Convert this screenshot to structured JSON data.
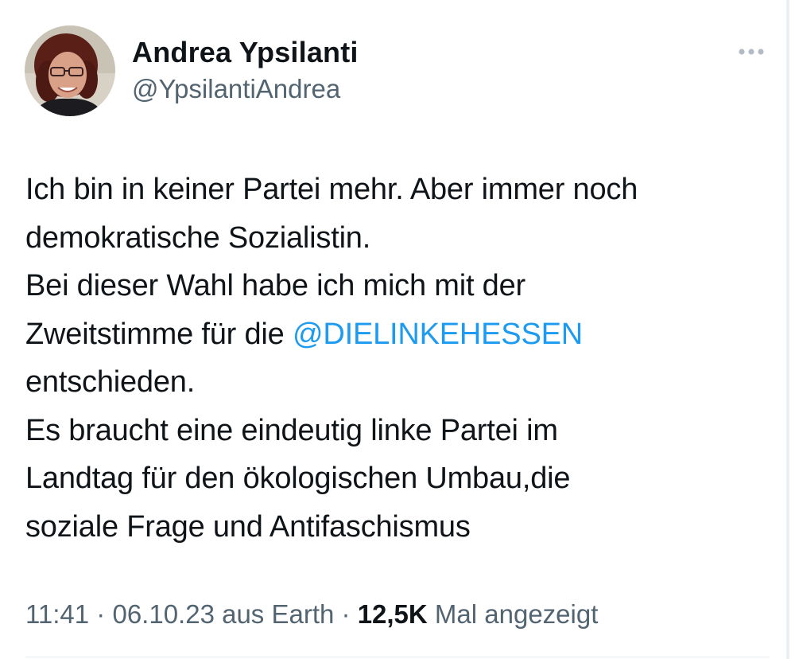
{
  "author": {
    "display_name": "Andrea Ypsilanti",
    "handle": "@YpsilantiAndrea",
    "avatar_icon": "profile-photo"
  },
  "more_icon": "more-horizontal-icon",
  "tweet": {
    "lines": [
      {
        "text": "Ich bin in keiner Partei mehr. Aber immer noch"
      },
      {
        "text": "demokratische Sozialistin."
      },
      {
        "text": "Bei dieser Wahl habe ich mich mit der"
      },
      {
        "prefix": "Zweitstimme für die ",
        "mention": "@DIELINKEHESSEN"
      },
      {
        "text": "entschieden."
      },
      {
        "text": "Es braucht eine eindeutig linke Partei im"
      },
      {
        "text": "Landtag für den ökologischen Umbau,die"
      },
      {
        "text": "soziale Frage und Antifaschismus"
      }
    ]
  },
  "meta": {
    "time": "11:41",
    "sep1": " · ",
    "date": "06.10.23",
    "location": " aus Earth",
    "sep2": " · ",
    "views_count": "12,5K",
    "views_label": " Mal angezeigt"
  },
  "colors": {
    "text": "#0f1419",
    "secondary": "#536471",
    "link": "#1d9bf0"
  }
}
